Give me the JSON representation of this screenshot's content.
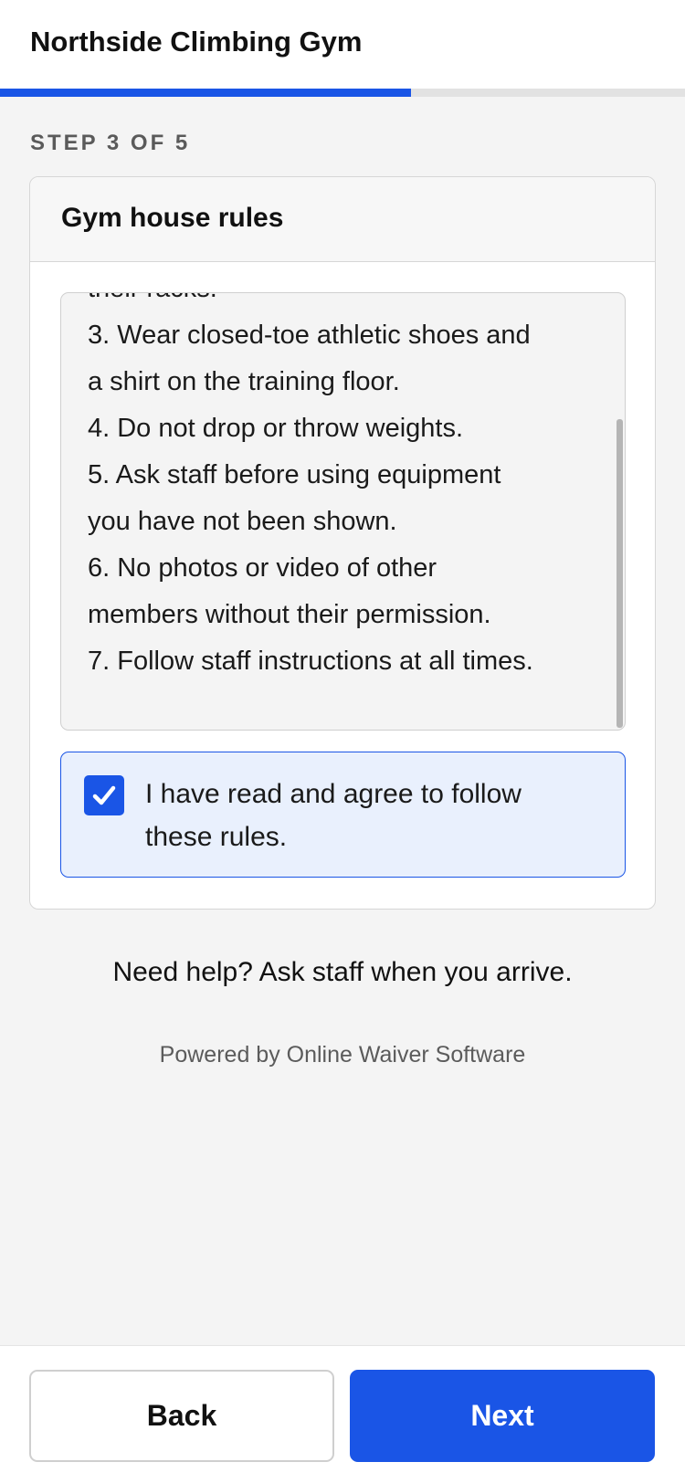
{
  "header": {
    "title": "Northside Climbing Gym"
  },
  "progress": {
    "current_step": 3,
    "total_steps": 5,
    "fraction": 0.6,
    "accent_color": "#1a55e6"
  },
  "step_label": "STEP 3 OF 5",
  "card": {
    "title": "Gym house rules",
    "rules_lines": [
      "their racks.",
      "3. Wear closed-toe athletic shoes and",
      "a shirt on the training floor.",
      "4. Do not drop or throw weights.",
      "5. Ask staff before using equipment",
      "you have not been shown.",
      "6. No photos or video of other",
      "members without their permission.",
      "7. Follow staff instructions at all times."
    ],
    "agreement": {
      "checked": true,
      "label": "I have read and agree to follow these rules."
    }
  },
  "help_text": "Need help? Ask staff when you arrive.",
  "powered_by": "Powered by Online Waiver Software",
  "footer": {
    "back_label": "Back",
    "next_label": "Next"
  },
  "icons": {
    "checkbox": "checkmark-icon"
  }
}
